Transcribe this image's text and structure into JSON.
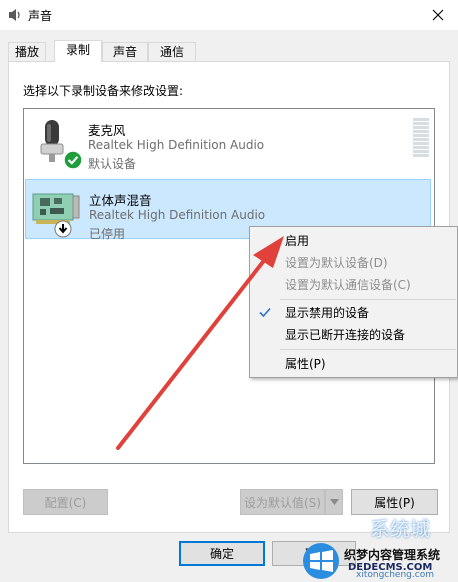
{
  "window": {
    "title": "声音",
    "icon": "speaker-icon",
    "close_icon": "close-icon"
  },
  "tabs": [
    {
      "label": "播放",
      "active": false
    },
    {
      "label": "录制",
      "active": true
    },
    {
      "label": "声音",
      "active": false
    },
    {
      "label": "通信",
      "active": false
    }
  ],
  "panel": {
    "instruction": "选择以下录制设备来修改设置:"
  },
  "devices": [
    {
      "name": "麦克风",
      "driver": "Realtek High Definition Audio",
      "status": "默认设备",
      "icon": "microphone-icon",
      "badge": "default-check-icon",
      "selected": false
    },
    {
      "name": "立体声混音",
      "driver": "Realtek High Definition Audio",
      "status": "已停用",
      "icon": "sound-card-icon",
      "badge": "disabled-arrow-icon",
      "selected": true
    }
  ],
  "buttons": {
    "configure": "配置(C)",
    "set_default": "设为默认值(S)",
    "properties": "属性(P)",
    "ok": "确定",
    "cancel": "取"
  },
  "context_menu": {
    "items": [
      {
        "label": "启用",
        "enabled": true
      },
      {
        "label": "设置为默认设备(D)",
        "enabled": false
      },
      {
        "label": "设置为默认通信设备(C)",
        "enabled": false
      },
      {
        "label": "显示禁用的设备",
        "enabled": true,
        "checked": true
      },
      {
        "label": "显示已断开连接的设备",
        "enabled": true
      },
      {
        "label": "属性(P)",
        "enabled": true
      }
    ]
  },
  "watermark": {
    "top_text": "系统城",
    "brand_text": "织梦内容管理系统",
    "url_text": "DEDECMS.COM",
    "sub_text": "xitongcheng.com"
  },
  "colors": {
    "accent": "#0078d7",
    "selection": "#cce8ff",
    "arrow": "#e0413a",
    "check_green": "#1e9e3a"
  }
}
